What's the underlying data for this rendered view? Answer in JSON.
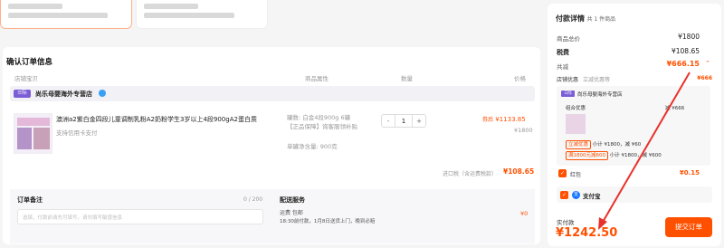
{
  "store_name": "尚乐母婴海外专营店",
  "order": {
    "title": "确认订单信息",
    "col_store": "店铺宝贝",
    "col_attr": "商品属性",
    "col_qty": "数量",
    "col_price": "价格",
    "product_name": "澳洲a2紫白金四段儿童调制乳粉A2奶粉学生3岁以上4段900gA2蛋白质",
    "payment_note": "支持信用卡支付",
    "attrs": [
      "罐数: 白金4段900g 6罐 【正品保障】询客服领补贴",
      "单罐净含量: 900克"
    ],
    "qty": "1",
    "qty_minus": "-",
    "qty_plus": "+",
    "price_label": "券后",
    "price_now": "¥1133.85",
    "price_orig": "¥1800",
    "tax_label": "进口税（含运费税款）",
    "tax_value": "¥108.65"
  },
  "remark": {
    "title": "订单备注",
    "count": "0 / 200",
    "placeholder": "选填，付款前请先可填写，请勿填写敏感信息"
  },
  "delivery": {
    "title": "配送服务",
    "method": "运费 包邮",
    "detail": "18:30前付款，1月8日送货上门，晚到必赔",
    "fee": "¥0"
  },
  "summary": {
    "title": "付款详情",
    "count_text": "共 1 件商品",
    "rows": [
      {
        "label": "商品总价",
        "value": "¥1800"
      },
      {
        "label": "税费",
        "value": "¥108.65"
      },
      {
        "label": "共减",
        "value": "¥666.15"
      }
    ],
    "store_discount_label": "店铺优惠",
    "store_discount_sub": "立减优惠等",
    "store_discount_value": "¥666",
    "combo_label": "组合优惠",
    "combo_value": "减 ¥666",
    "tag1": "立减优惠",
    "tag1_text": "小计 ¥1800，减 ¥60",
    "tag2": "满1800元减600",
    "tag2_text": "小计 ¥1800，减 ¥600",
    "hongbao_label": "红包",
    "hongbao_value": "¥0.15",
    "alipay_label": "支付宝",
    "paid_label": "实付款",
    "paid_value": "¥1242.50",
    "submit": "提交订单"
  },
  "colors": {
    "accent": "#ff5000",
    "arrow": "#e8322b"
  }
}
